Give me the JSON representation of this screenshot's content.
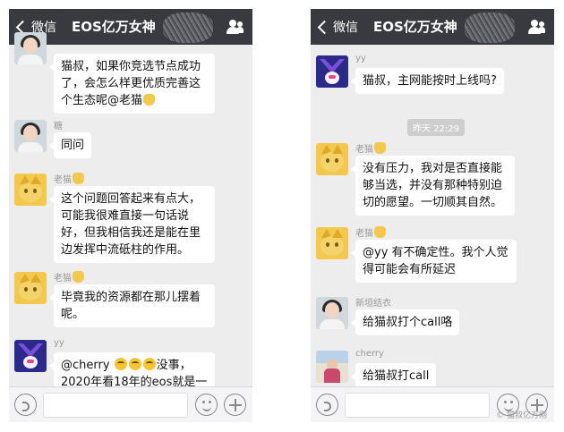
{
  "left": {
    "back_label": "微信",
    "title": "EOS亿万女神",
    "messages": [
      {
        "sender": "",
        "text": "猫叔，如果你竞选节点成功了，会怎么样更优质完善这个生态呢@老猫"
      },
      {
        "sender": "糖",
        "text": "同问"
      },
      {
        "sender": "老猫",
        "text": "这个问题回答起来有点大，可能我很难直接一句话说好，但我相信我还是能在里边发挥中流砥柱的作用。"
      },
      {
        "sender": "老猫",
        "text": "毕竟我的资源都在那儿摆着呢。"
      },
      {
        "sender": "yy",
        "text_a": "@cherry ",
        "text_b": "没事，2020年看18年的eos就是一"
      }
    ]
  },
  "right": {
    "back_label": "微信",
    "title": "EOS亿万女神",
    "time_label": "昨天 22:29",
    "watermark": "© 猫叔亿万刚",
    "messages": [
      {
        "sender": "yy",
        "text": "猫叔，主网能按时上线吗?"
      },
      {
        "sender": "老猫",
        "text": "没有压力，我对是否直接能够当选，并没有那种特别迫切的愿望。一切顺其自然。"
      },
      {
        "sender": "老猫",
        "text": "@yy 有不确定性。我个人觉得可能会有所延迟"
      },
      {
        "sender": "新垣结衣",
        "text": "给猫叔打个call咯"
      },
      {
        "sender": "cherry",
        "text": "给猫叔打call"
      }
    ]
  },
  "icons": {
    "back": "chevron-left-icon",
    "contacts": "group-contacts-icon",
    "voice": "voice-icon",
    "emoji": "emoji-icon",
    "plus": "plus-icon"
  },
  "colors": {
    "header_bg": "#393a3f",
    "chat_bg": "#ededed",
    "bubble_bg": "#ffffff"
  }
}
